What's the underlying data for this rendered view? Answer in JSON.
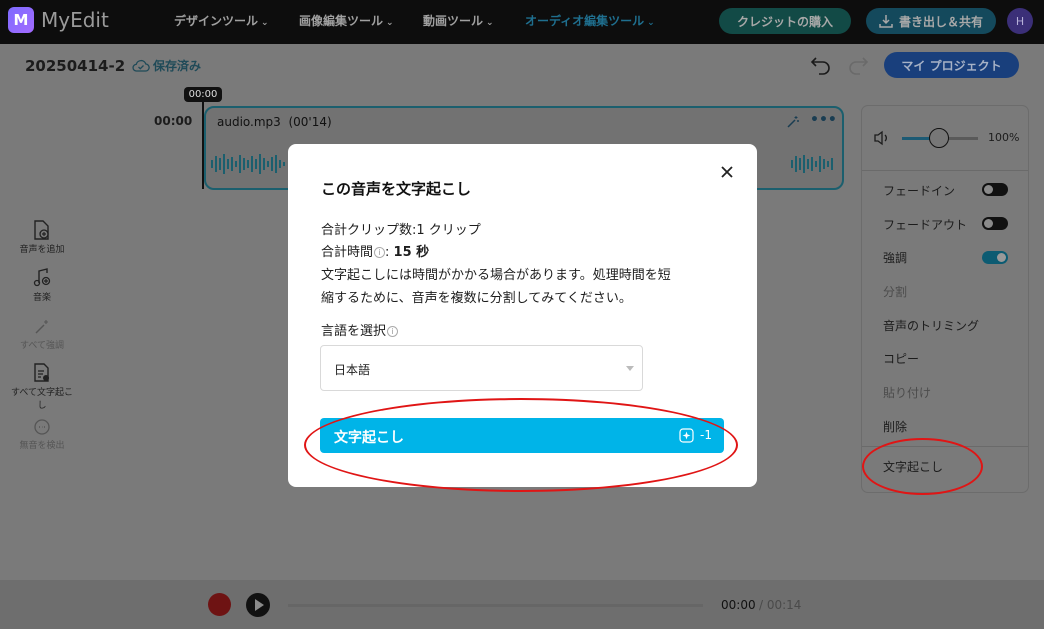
{
  "app": {
    "name": "MyEdit"
  },
  "nav": {
    "items": [
      {
        "label": "デザインツール"
      },
      {
        "label": "画像編集ツール"
      },
      {
        "label": "動画ツール"
      },
      {
        "label": "オーディオ編集ツール"
      }
    ],
    "active_index": 3,
    "credit_button": "クレジットの購入",
    "export_button": "書き出し＆共有",
    "avatar_initial": "H"
  },
  "project": {
    "name": "20250414-2",
    "saved_status": "保存済み",
    "my_project_button": "マイ プロジェクト"
  },
  "timeline": {
    "playhead": "00:00",
    "track_time": "00:00",
    "clip_name": "audio.mp3",
    "clip_duration": "(00'14)"
  },
  "tools": [
    {
      "label": "音声を追加",
      "icon": "file-add-icon",
      "enabled": true
    },
    {
      "label": "音楽",
      "icon": "music-add-icon",
      "enabled": true
    },
    {
      "label": "すべて強調",
      "icon": "magic-wand-icon",
      "enabled": false
    },
    {
      "label": "すべて文字起こし",
      "icon": "transcribe-all-icon",
      "enabled": true
    },
    {
      "label": "無音を検出",
      "icon": "silence-detect-icon",
      "enabled": false
    }
  ],
  "right_panel": {
    "volume": "100%",
    "volume_level": 0.5,
    "items": [
      {
        "label": "フェードイン",
        "toggle": "off",
        "enabled": true
      },
      {
        "label": "フェードアウト",
        "toggle": "off",
        "enabled": true
      },
      {
        "label": "強調",
        "toggle": "on",
        "enabled": true
      },
      {
        "label": "分割",
        "enabled": false
      },
      {
        "label": "音声のトリミング",
        "enabled": true
      },
      {
        "label": "コピー",
        "enabled": true
      },
      {
        "label": "貼り付け",
        "enabled": false
      },
      {
        "label": "削除",
        "enabled": true
      },
      {
        "label": "文字起こし",
        "enabled": true
      }
    ]
  },
  "player": {
    "current": "00:00",
    "total": "/ 00:14"
  },
  "modal": {
    "title": "この音声を文字起こし",
    "clip_count_label": "合計クリップ数:1 クリップ",
    "total_time_label": "合計時間",
    "total_time_sep": ": ",
    "total_time_value": "15 秒",
    "notice_line1": "文字起こしには時間がかかる場合があります。処理時間を短",
    "notice_line2": "縮するために、音声を複数に分割してみてください。",
    "language_label": "言語を選択",
    "language_value": "日本語",
    "transcribe_button": "文字起こし",
    "credit_cost": "-1"
  },
  "colors": {
    "accent": "#00b4e8",
    "annotation": "#e01515"
  }
}
